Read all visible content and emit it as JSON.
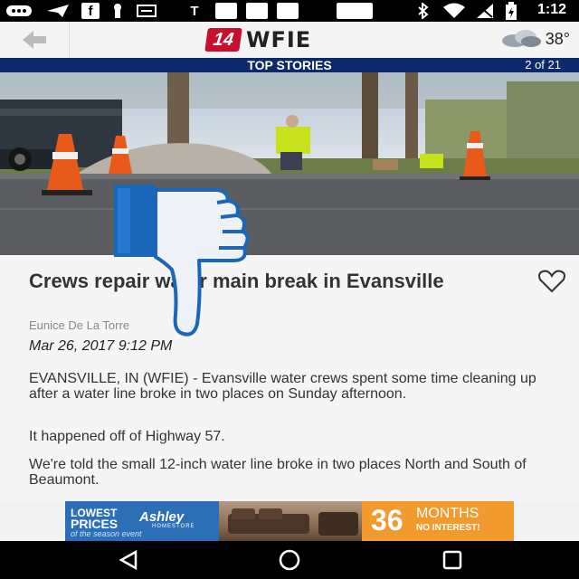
{
  "status_bar": {
    "time": "1:12",
    "icons": [
      "messaging-icon",
      "send-icon",
      "facebook-icon",
      "notification-icon",
      "gallery-icon",
      "t-icon",
      "app-icon",
      "app-icon",
      "app-icon",
      "app-icon",
      "bluetooth-icon",
      "wifi-icon",
      "signal-icon",
      "battery-icon"
    ],
    "t_glyph": "T",
    "f_glyph": "f"
  },
  "app_bar": {
    "logo_number": "14",
    "logo_text": "WFIE",
    "temperature": "38°",
    "icons": [
      "back-arrow-icon",
      "weather-cloudy-icon"
    ]
  },
  "section": {
    "title": "TOP STORIES",
    "counter": "2 of 21"
  },
  "article": {
    "headline": "Crews repair water main break in Evansville",
    "author": "Eunice De La Torre",
    "date": "Mar 26, 2017 9:12 PM",
    "paragraphs": [
      "EVANSVILLE, IN (WFIE) - Evansville water crews spent some time cleaning up after a water line broke in two places on Sunday afternoon.",
      "It happened off of Highway 57.",
      "We're told the small 12-inch water line broke in two places North and South of Beaumont."
    ],
    "favorite_icon": "heart-outline-icon",
    "overlay_icon": "thumbs-down-icon"
  },
  "ad": {
    "line1": "LOWEST",
    "line2": "PRICES",
    "line3": "of the season event",
    "brand": "Ashley",
    "brand_sub": "HOMESTORE",
    "big_number": "36",
    "months": "MONTHS",
    "offer": "NO INTEREST!"
  },
  "nav": {
    "icons": [
      "back-triangle-icon",
      "home-circle-icon",
      "recents-square-icon"
    ]
  },
  "colors": {
    "section_bar": "#0c2a6b",
    "logo_red": "#c8102e",
    "ad_blue": "#2c6fb6",
    "ad_orange": "#f29a2e",
    "thumb_blue": "#1a66b8"
  }
}
